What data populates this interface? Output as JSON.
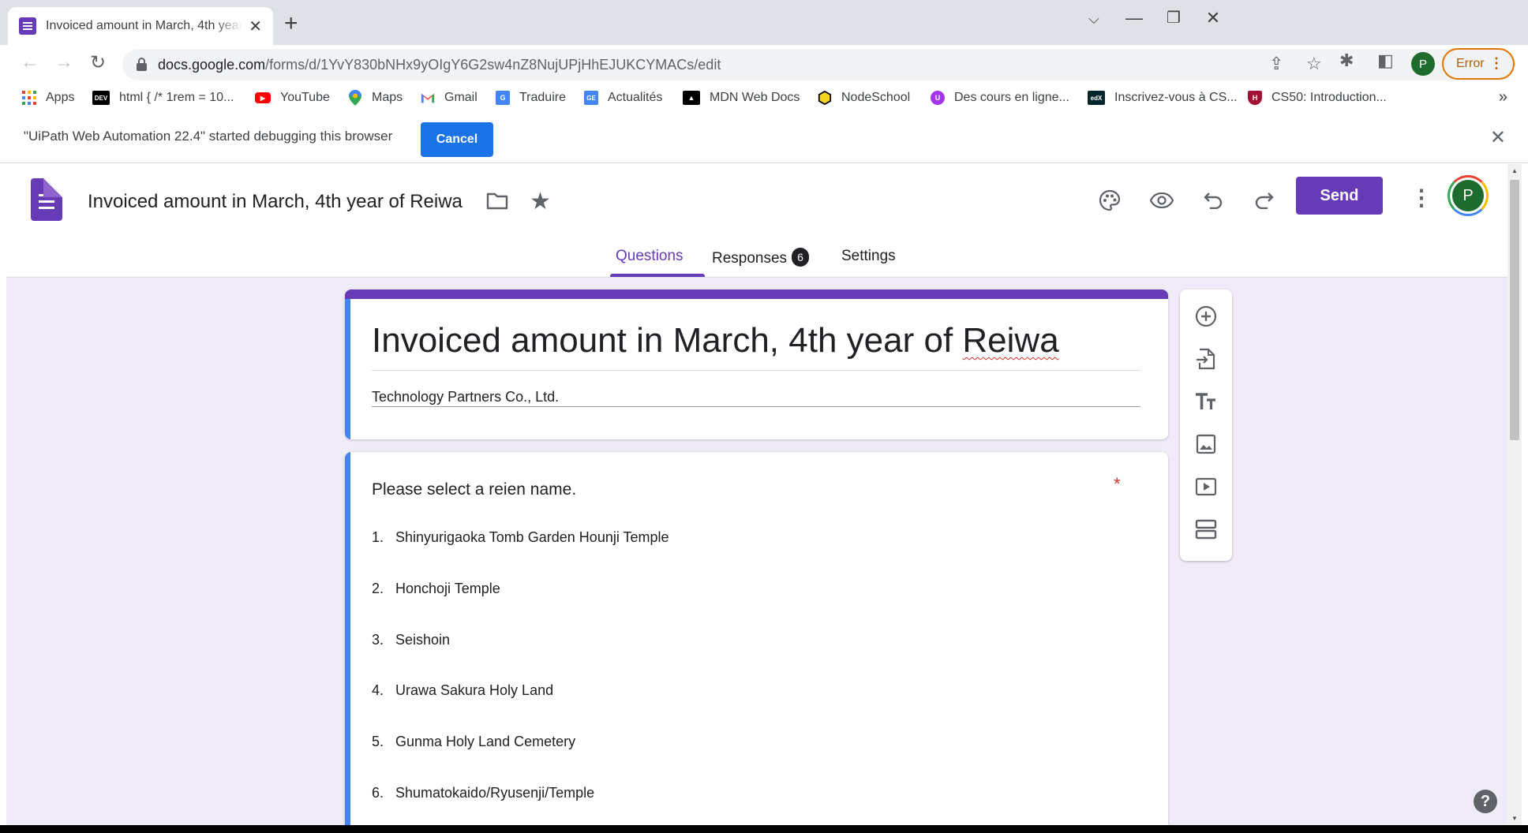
{
  "browser": {
    "tab_title": "Invoiced amount in March, 4th year of Reiwa",
    "url_host": "docs.google.com",
    "url_path": "/forms/d/1YvY830bNHx9yOIgY6G2sw4nZ8NujUPjHhEJUKCYMACs/edit",
    "profile_initial": "P",
    "error_label": "Error",
    "bookmarks": [
      {
        "label": "Apps",
        "icon": "apps-grid-icon"
      },
      {
        "label": "html { /* 1rem = 10...",
        "icon": "dev-icon",
        "badge": "DEV"
      },
      {
        "label": "YouTube",
        "icon": "youtube-icon"
      },
      {
        "label": "Maps",
        "icon": "maps-icon"
      },
      {
        "label": "Gmail",
        "icon": "gmail-icon"
      },
      {
        "label": "Traduire",
        "icon": "translate-icon"
      },
      {
        "label": "Actualités",
        "icon": "news-icon"
      },
      {
        "label": "MDN Web Docs",
        "icon": "mdn-icon"
      },
      {
        "label": "NodeSchool",
        "icon": "nodeschool-icon"
      },
      {
        "label": "Des cours en ligne...",
        "icon": "udemy-icon"
      },
      {
        "label": "Inscrivez-vous à CS...",
        "icon": "edx-icon"
      },
      {
        "label": "CS50: Introduction...",
        "icon": "harvard-icon"
      }
    ],
    "more_bookmarks": "»"
  },
  "infobar": {
    "message": "\"UiPath Web Automation 22.4\" started debugging this browser",
    "cancel_label": "Cancel",
    "close": "✕"
  },
  "forms": {
    "doc_title": "Invoiced amount in March, 4th year of Reiwa",
    "send_label": "Send",
    "avatar_initial": "P",
    "tabs": [
      {
        "label": "Questions",
        "active": true
      },
      {
        "label": "Responses",
        "badge": "6"
      },
      {
        "label": "Settings"
      }
    ]
  },
  "form": {
    "title_main": "Invoiced amount in March, 4th year of ",
    "title_last": "Reiwa",
    "description": "Technology Partners Co., Ltd.",
    "question": {
      "title": "Please select a reien name.",
      "required_mark": "*",
      "options": [
        {
          "num": "1.",
          "label": "Shinyurigaoka Tomb Garden Hounji Temple"
        },
        {
          "num": "2.",
          "label": "Honchoji Temple"
        },
        {
          "num": "3.",
          "label": "Seishoin"
        },
        {
          "num": "4.",
          "label": "Urawa Sakura Holy Land"
        },
        {
          "num": "5.",
          "label": "Gunma Holy Land Cemetery"
        },
        {
          "num": "6.",
          "label": "Shumatokaido/Ryusenji/Temple"
        }
      ]
    }
  },
  "help": "?",
  "colors": {
    "accent": "#673ab7",
    "canvas": "#f0ebf8",
    "focus_bar": "#4285f4",
    "chrome_blue": "#1a73e8"
  }
}
